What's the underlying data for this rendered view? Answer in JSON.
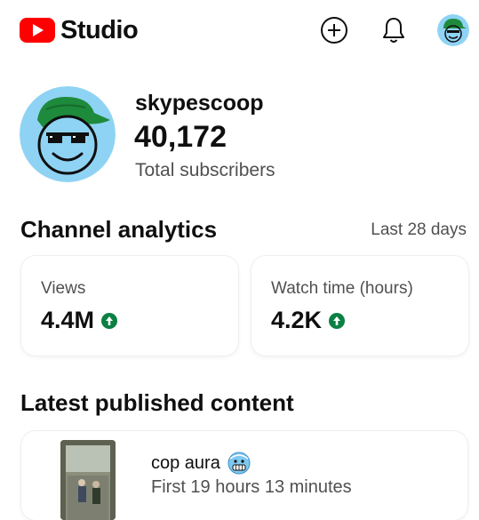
{
  "app": {
    "brand": "Studio",
    "logo_color": "#ff0000"
  },
  "header": {
    "icons": [
      "create-plus-icon",
      "notifications-bell-icon",
      "account-avatar"
    ]
  },
  "channel": {
    "name": "skypescoop",
    "subscribers": "40,172",
    "subscribers_label": "Total subscribers",
    "avatar_bg": "#8fd3f4",
    "cap_color": "#1e8a3c"
  },
  "analytics": {
    "title": "Channel analytics",
    "period": "Last 28 days",
    "cards": [
      {
        "label": "Views",
        "value": "4.4M",
        "trend": "up"
      },
      {
        "label": "Watch time (hours)",
        "value": "4.2K",
        "trend": "up"
      }
    ],
    "trend_color": "#0b8043"
  },
  "latest": {
    "title": "Latest published content",
    "items": [
      {
        "title": "cop aura",
        "emoji": "freezing-face",
        "meta": "First 19 hours 13 minutes"
      }
    ]
  }
}
